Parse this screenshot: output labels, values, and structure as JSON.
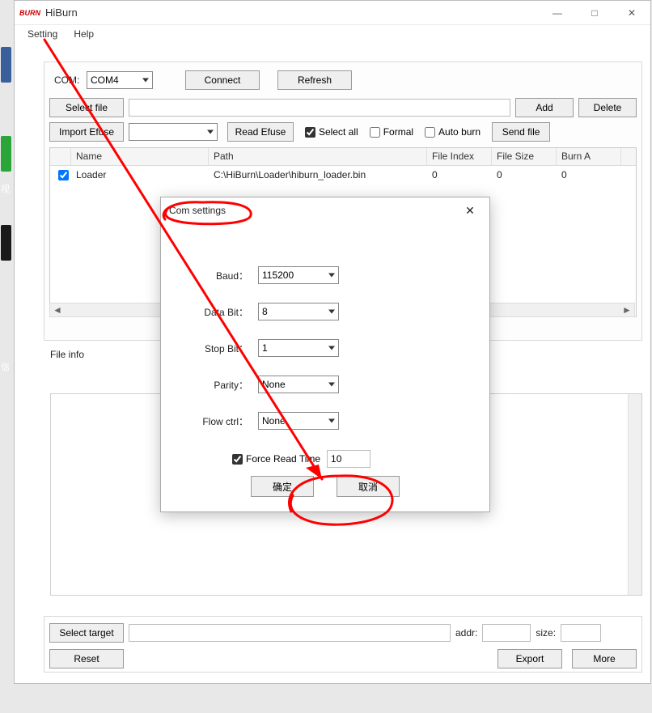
{
  "window": {
    "logo": "BURN",
    "title": "HiBurn",
    "buttons": {
      "min": "—",
      "max": "□",
      "close": "✕"
    }
  },
  "menu": {
    "setting": "Setting",
    "help": "Help"
  },
  "com": {
    "label": "COM:",
    "value": "COM4",
    "connect": "Connect",
    "refresh": "Refresh"
  },
  "filebar": {
    "select_file": "Select file",
    "path": "",
    "add": "Add",
    "delete": "Delete"
  },
  "efuse": {
    "import_efuse": "Import Efuse",
    "value": "",
    "read_efuse": "Read Efuse",
    "select_all": "Select all",
    "formal": "Formal",
    "auto_burn": "Auto burn",
    "send_file": "Send file"
  },
  "table": {
    "headers": {
      "chk": "",
      "name": "Name",
      "path": "Path",
      "file_index": "File Index",
      "file_size": "File Size",
      "burn_addr": "Burn A"
    },
    "rows": [
      {
        "checked": true,
        "name": "Loader",
        "path": "C:\\HiBurn\\Loader\\hiburn_loader.bin",
        "file_index": "0",
        "file_size": "0",
        "burn_addr": "0"
      }
    ]
  },
  "file_info_label": "File info",
  "bottom": {
    "select_target": "Select target",
    "target_value": "",
    "addr_label": "addr:",
    "addr_value": "",
    "size_label": "size:",
    "size_value": "",
    "reset": "Reset",
    "export": "Export",
    "more": "More"
  },
  "dialog": {
    "title": "Com settings",
    "baud_label": "Baud：",
    "baud_value": "115200",
    "data_bit_label": "Data Bit：",
    "data_bit_value": "8",
    "stop_bit_label": "Stop Bit：",
    "stop_bit_value": "1",
    "parity_label": "Parity：",
    "parity_value": "None",
    "flow_label": "Flow ctrl：",
    "flow_value": "None",
    "force_read_label": "Force Read Time",
    "force_read_checked": true,
    "force_read_value": "10",
    "ok": "确定",
    "cancel": "取消",
    "close": "✕"
  },
  "annotation": {
    "color": "#ff0000",
    "stroke": 3
  }
}
